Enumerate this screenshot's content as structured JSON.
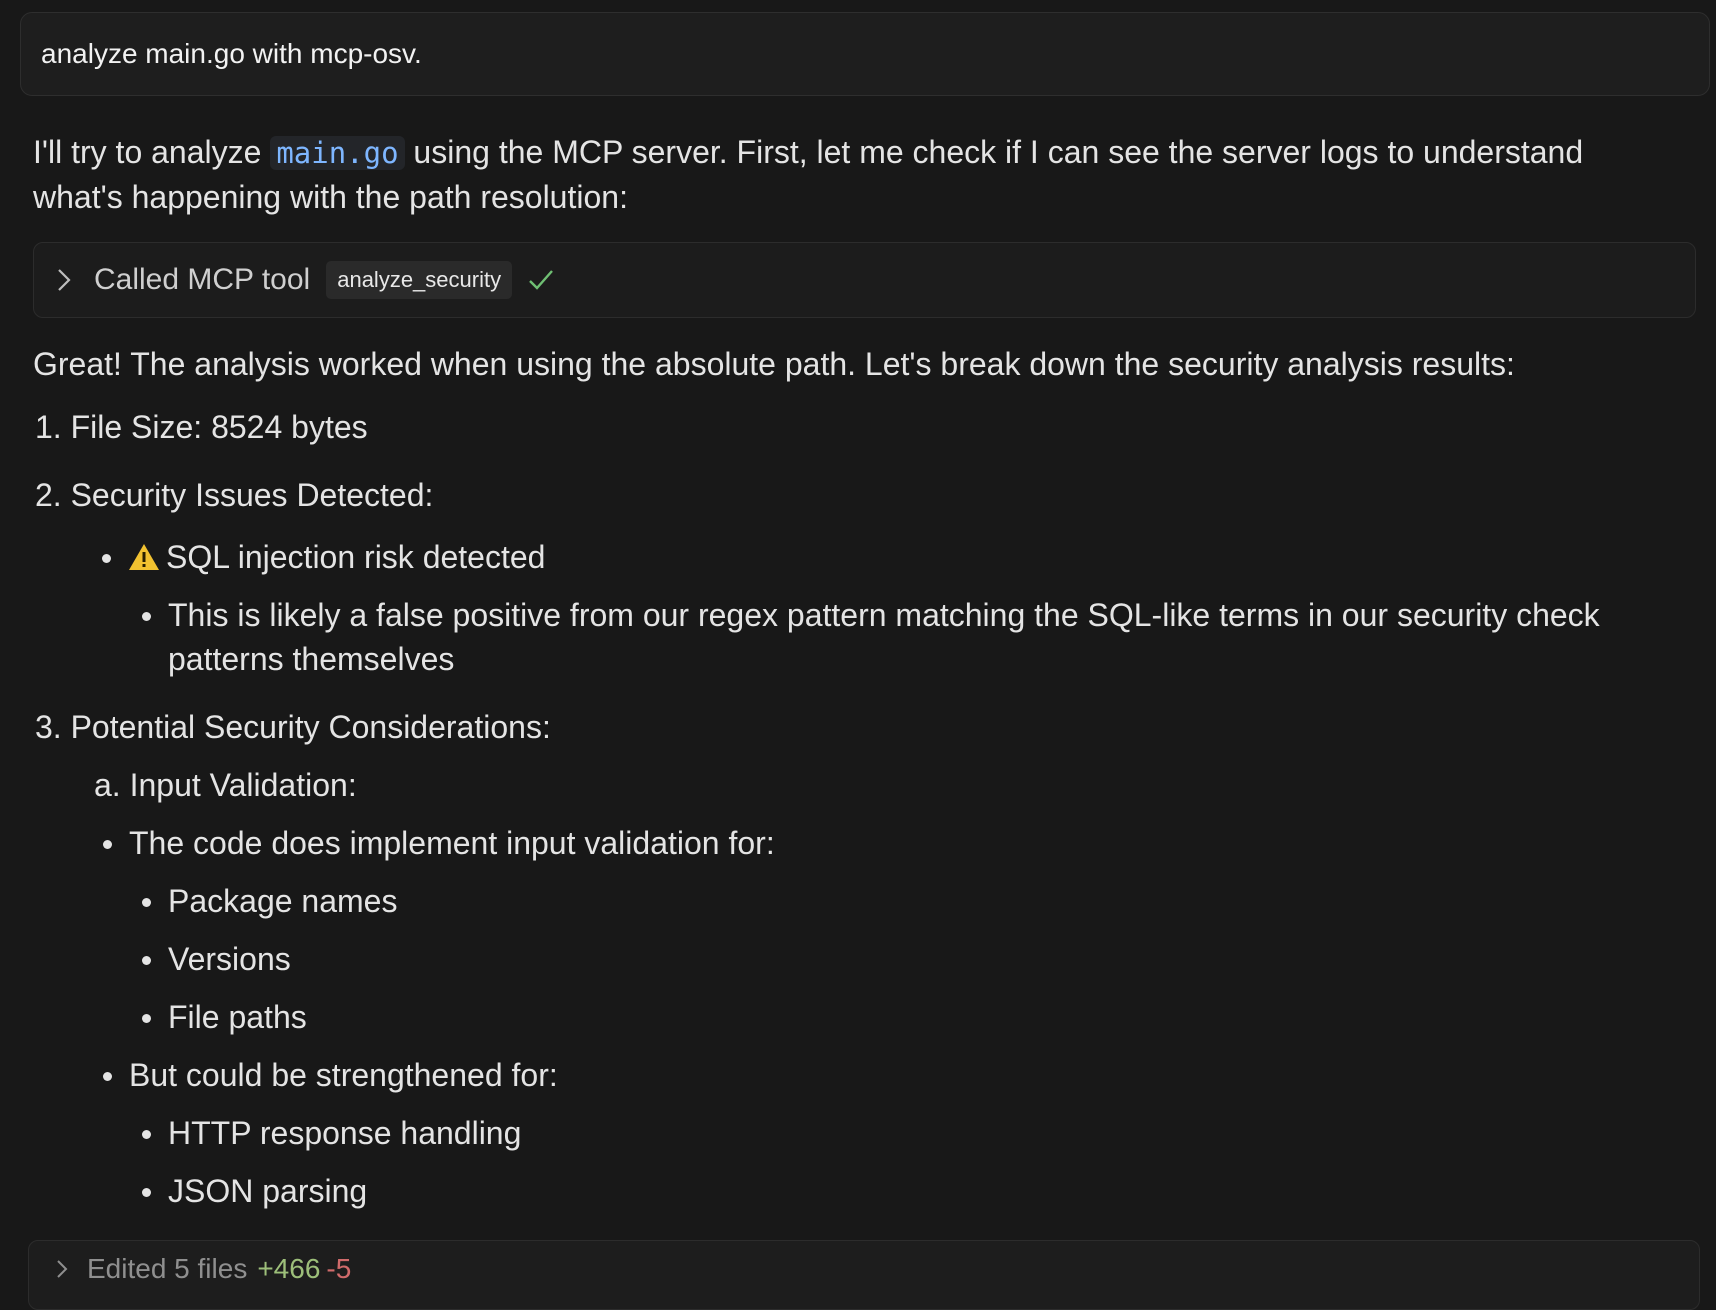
{
  "user_message": "analyze main.go with mcp-osv.",
  "intro": {
    "before": "I'll try to analyze",
    "code": "main.go",
    "after": "using the MCP server. First, let me check if I can see the server logs to understand",
    "line2": "what's happening with the path resolution:"
  },
  "tool_call": {
    "label": "Called MCP tool",
    "tool_name": "analyze_security",
    "status_icon": "check-icon"
  },
  "summary": "Great! The analysis worked when using the absolute path. Let's break down the security analysis results:",
  "items": {
    "i1": "1. File Size: 8524 bytes",
    "i2": "2. Security Issues Detected:",
    "i2_sub": "SQL injection risk detected",
    "i2_note_1": "This is likely a false positive from our regex pattern matching the SQL-like terms in our security check",
    "i2_note_2": "patterns themselves",
    "i3": "3. Potential Security Considerations:",
    "i3a": "a. Input Validation:",
    "b1": "The code does implement input validation for:",
    "b1_1": "Package names",
    "b1_2": "Versions",
    "b1_3": "File paths",
    "b2": "But could be strengthened for:",
    "b2_1": "HTTP response handling",
    "b2_2": "JSON parsing"
  },
  "edited": {
    "label": "Edited 5 files",
    "additions": "+466",
    "deletions": "-5"
  },
  "colors": {
    "background": "#181818",
    "code_accent": "#7eb6ff",
    "check": "#6fbf73",
    "additions": "#9dbf7a",
    "deletions": "#d06b6b"
  }
}
